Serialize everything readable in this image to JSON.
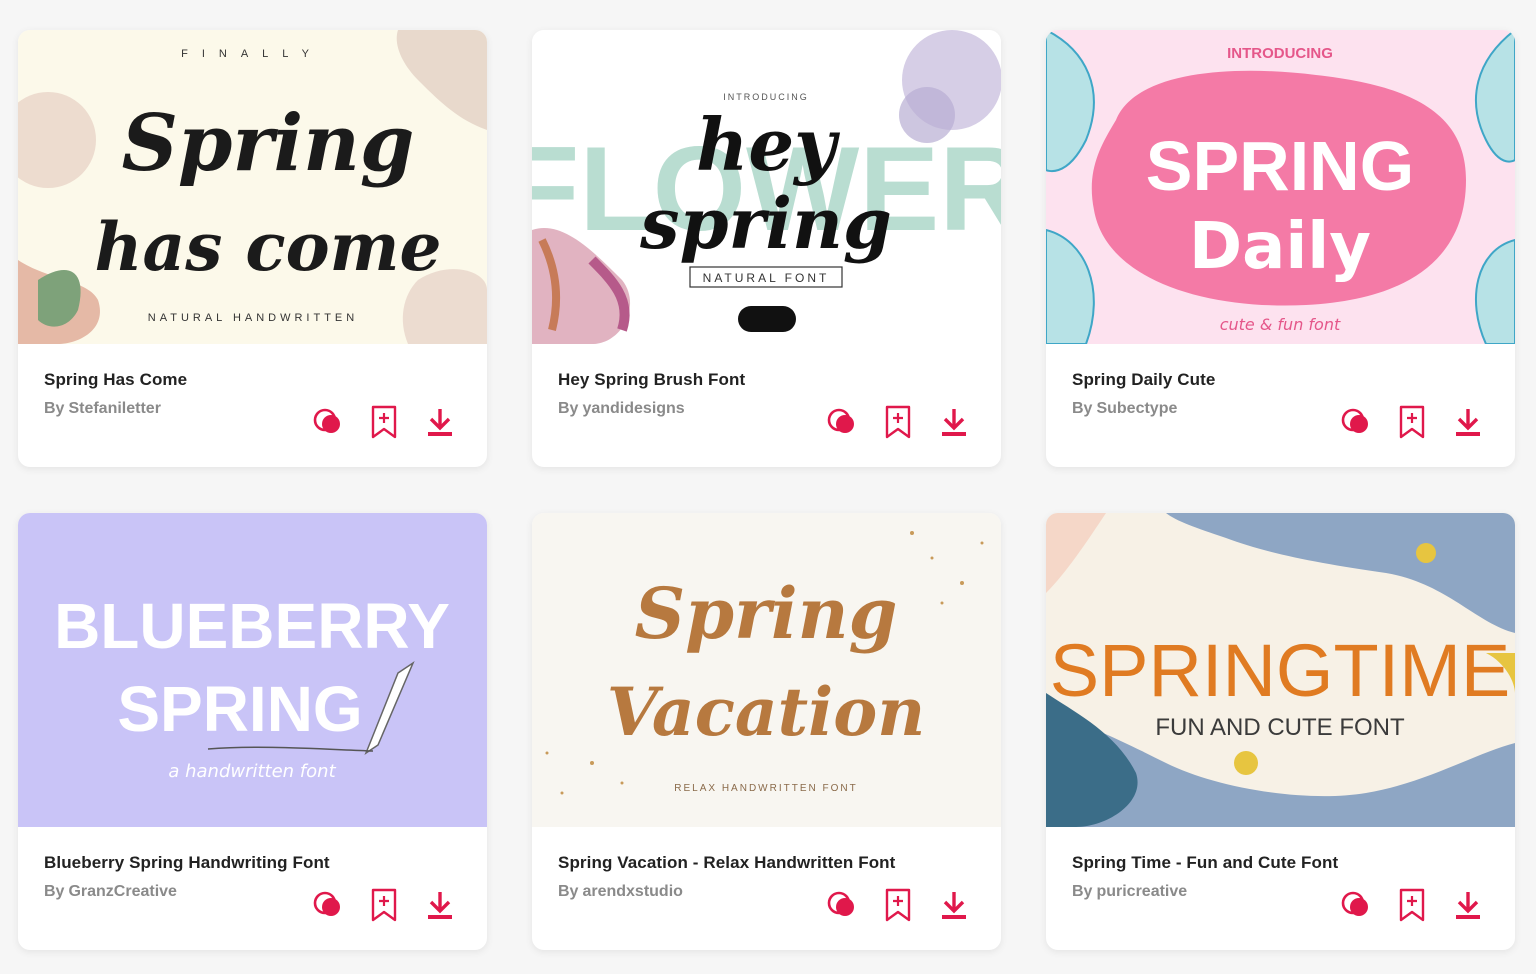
{
  "accent": "#e0184b",
  "cards": [
    {
      "title": "Spring Has Come",
      "by": "By",
      "author": "Stefaniletter",
      "art": {
        "top": "FINALLY",
        "line1": "Spring",
        "line2": "has come",
        "bottom": "NATURAL HANDWRITTEN",
        "bg": "#fcf9ea"
      }
    },
    {
      "title": "Hey Spring Brush Font",
      "by": "By",
      "author": "yandidesigns",
      "art": {
        "top": "INTRODUCING",
        "back": "FLOWER",
        "line1": "hey",
        "line2": "spring",
        "bottom": "NATURAL FONT",
        "bg": "#ffffff"
      }
    },
    {
      "title": "Spring Daily Cute",
      "by": "By",
      "author": "Subectype",
      "art": {
        "top": "INTRODUCING",
        "line1": "SPRING",
        "line2": "Daily",
        "bottom": "cute & fun font",
        "bg": "#fde2ef"
      }
    },
    {
      "title": "Blueberry Spring Handwriting Font",
      "by": "By",
      "author": "GranzCreative",
      "art": {
        "line1": "BLUEBERRY",
        "line2": "SPRING",
        "bottom": "a handwritten font",
        "bg": "#c9c4f7"
      }
    },
    {
      "title": "Spring Vacation - Relax Handwritten Font",
      "by": "By",
      "author": "arendxstudio",
      "art": {
        "line1": "Spring",
        "line2": "Vacation",
        "bottom": "RELAX HANDWRITTEN FONT",
        "bg": "#f8f6f1"
      }
    },
    {
      "title": "Spring Time - Fun and Cute Font",
      "by": "By",
      "author": "puricreative",
      "art": {
        "line1": "SPRINGTIME",
        "line2": "FUN AND CUTE FONT",
        "bg": "#f7f1e6"
      }
    }
  ],
  "icons": [
    "compare-icon",
    "bookmark-icon",
    "download-icon"
  ]
}
